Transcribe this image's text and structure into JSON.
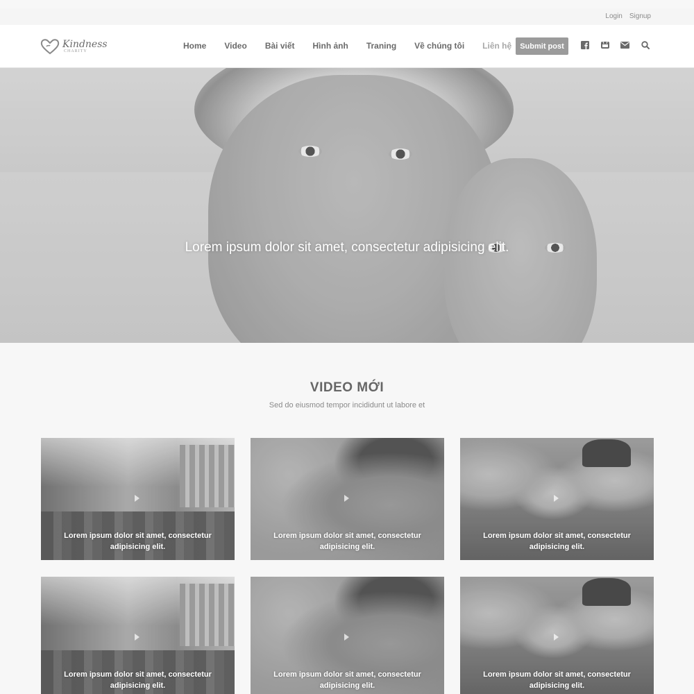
{
  "topbar": {
    "login": "Login",
    "signup": "Signup"
  },
  "brand": {
    "name": "Kindness",
    "sub": "CHARITY"
  },
  "nav": {
    "items": [
      {
        "label": "Home",
        "active": false
      },
      {
        "label": "Video",
        "active": false
      },
      {
        "label": "Bài viết",
        "active": false
      },
      {
        "label": "Hình ảnh",
        "active": false
      },
      {
        "label": "Traning",
        "active": false
      },
      {
        "label": "Về chúng tôi",
        "active": false
      },
      {
        "label": "Liên hệ",
        "active": true
      }
    ],
    "submit_label": "Submit post",
    "icons": [
      "facebook-icon",
      "youtube-icon",
      "mail-icon",
      "search-icon"
    ]
  },
  "hero": {
    "caption": "Lorem ipsum dolor sit amet, consectetur adipisicing elit."
  },
  "section": {
    "title": "VIDEO MỚI",
    "subtitle": "Sed do eiusmod tempor incididunt ut labore et"
  },
  "videos": [
    {
      "photo": "street",
      "caption": "Lorem ipsum dolor sit amet, consectetur adipisicing elit."
    },
    {
      "photo": "boy",
      "caption": "Lorem ipsum dolor sit amet, consectetur adipisicing elit."
    },
    {
      "photo": "women",
      "caption": "Lorem ipsum dolor sit amet, consectetur adipisicing elit."
    },
    {
      "photo": "street",
      "caption": "Lorem ipsum dolor sit amet, consectetur adipisicing elit."
    },
    {
      "photo": "boy",
      "caption": "Lorem ipsum dolor sit amet, consectetur adipisicing elit."
    },
    {
      "photo": "women",
      "caption": "Lorem ipsum dolor sit amet, consectetur adipisicing elit."
    }
  ],
  "colors": {
    "accent": "#9b9b9b",
    "nav_text": "#6a6a6a",
    "nav_active": "#a8a8a8",
    "page_bg": "#f7f7f7"
  }
}
